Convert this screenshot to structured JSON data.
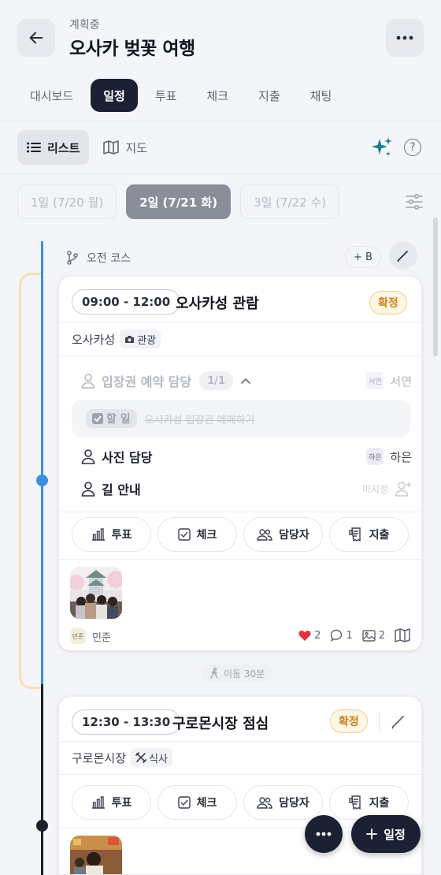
{
  "header": {
    "status": "계획중",
    "title": "오사카 벚꽃 여행"
  },
  "tabs": [
    {
      "label": "대시보드",
      "active": false
    },
    {
      "label": "일정",
      "active": true
    },
    {
      "label": "투표",
      "active": false
    },
    {
      "label": "체크",
      "active": false
    },
    {
      "label": "지출",
      "active": false
    },
    {
      "label": "채팅",
      "active": false
    }
  ],
  "view_toggle": {
    "list_label": "리스트",
    "map_label": "지도",
    "selected": "list",
    "help_glyph": "?"
  },
  "days": [
    {
      "label": "1일 (7/20 월)",
      "active": false
    },
    {
      "label": "2일 (7/21 화)",
      "active": true
    },
    {
      "label": "3일 (7/22 수)",
      "active": false
    }
  ],
  "course": {
    "label": "오전 코스",
    "add_button": "+ B"
  },
  "card1": {
    "time": "09:00 - 12:00",
    "title": "오사카성 관람",
    "status": "확정",
    "location": "오사카성",
    "category": "관광",
    "assignments": [
      {
        "label": "입장권 예약 담당",
        "count": "1/1",
        "assignee_initial": "서연",
        "assignee": "서연",
        "faded": true
      },
      {
        "label": "사진 담당",
        "assignee_initial": "하은",
        "assignee": "하은",
        "faded": false
      },
      {
        "label": "길 안내",
        "assignee": "미지정",
        "faded": false
      }
    ],
    "todo": {
      "chip": "할 일",
      "text": "오사카성 입장권 예매하기"
    },
    "actions": [
      "투표",
      "체크",
      "담당자",
      "지출"
    ],
    "author_initial": "민준",
    "author": "민준",
    "likes": "2",
    "comments": "1",
    "photos": "2"
  },
  "transit": {
    "label": "이동 30분"
  },
  "card2": {
    "time": "12:30 - 13:30",
    "title": "구로몬시장 점심",
    "status": "확정",
    "location": "구로몬시장",
    "category": "식사",
    "actions": [
      "투표",
      "체크",
      "담당자",
      "지출"
    ]
  },
  "fab": {
    "add_label": "일정"
  },
  "colors": {
    "primary_dark": "#1b2033",
    "timeline_blue": "#3b8ee0",
    "confirm_orange": "#c9801a",
    "sparkle_teal": "#1b7d8f",
    "like_red": "#e0333d"
  }
}
